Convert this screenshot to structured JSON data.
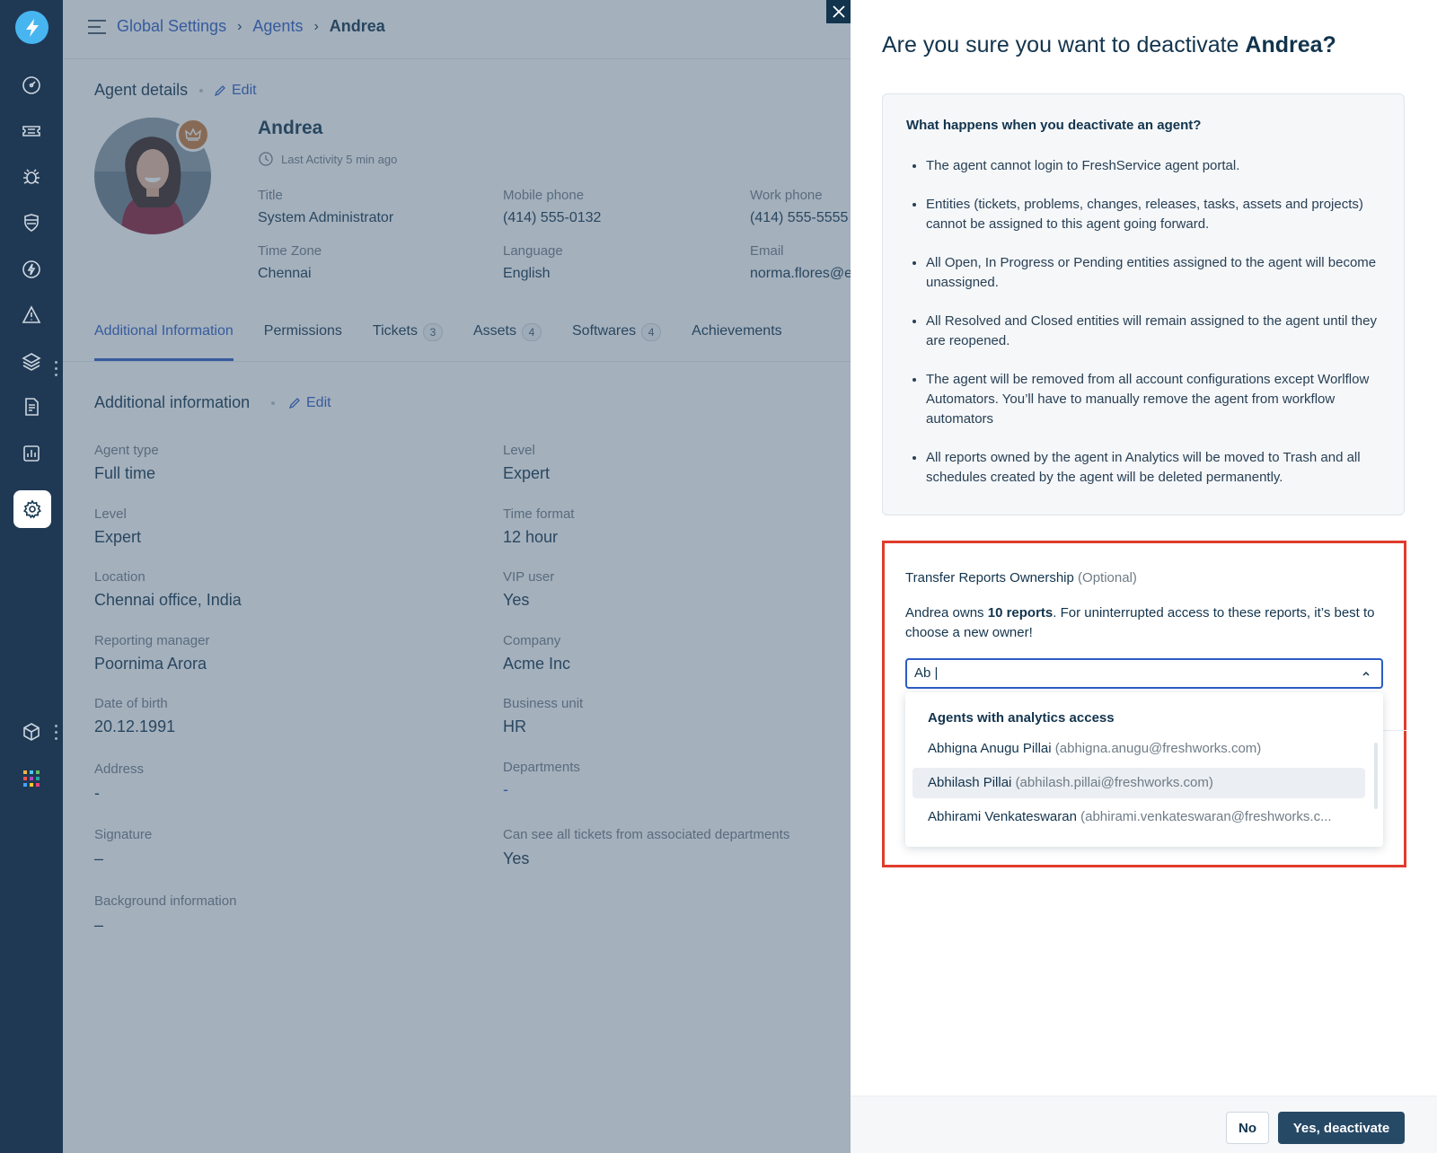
{
  "breadcrumb": {
    "root": "Global Settings",
    "section": "Agents",
    "current": "Andrea"
  },
  "agent_details": {
    "heading": "Agent details",
    "edit_label": "Edit",
    "name": "Andrea",
    "last_activity": "Last Activity 5 min ago",
    "fields": {
      "title_label": "Title",
      "title_value": "System Administrator",
      "mobile_label": "Mobile phone",
      "mobile_value": "(414) 555-0132",
      "work_label": "Work phone",
      "work_value": "(414) 555-5555",
      "tz_label": "Time Zone",
      "tz_value": "Chennai",
      "lang_label": "Language",
      "lang_value": "English",
      "email_label": "Email",
      "email_value": "norma.flores@e"
    }
  },
  "tabs": [
    {
      "label": "Additional Information"
    },
    {
      "label": "Permissions"
    },
    {
      "label": "Tickets",
      "count": "3"
    },
    {
      "label": "Assets",
      "count": "4"
    },
    {
      "label": "Softwares",
      "count": "4"
    },
    {
      "label": "Achievements"
    }
  ],
  "additional": {
    "heading": "Additional information",
    "edit_label": "Edit",
    "left": [
      {
        "label": "Agent type",
        "value": "Full time"
      },
      {
        "label": "Level",
        "value": "Expert"
      },
      {
        "label": "Location",
        "value": "Chennai office, India"
      },
      {
        "label": "Reporting manager",
        "value": "Poornima Arora"
      },
      {
        "label": "Date of birth",
        "value": "20.12.1991"
      },
      {
        "label": "Address",
        "value": "-"
      },
      {
        "label": "Signature",
        "value": "–"
      },
      {
        "label": "Background information",
        "value": "–"
      }
    ],
    "right": [
      {
        "label": "Level",
        "value": "Expert"
      },
      {
        "label": "Time format",
        "value": "12 hour"
      },
      {
        "label": "VIP user",
        "value": "Yes"
      },
      {
        "label": "Company",
        "value": "Acme Inc"
      },
      {
        "label": "Business unit",
        "value": "HR"
      },
      {
        "label": "Departments",
        "value": "-"
      },
      {
        "label": "Can see all tickets from associated departments",
        "value": "Yes"
      }
    ]
  },
  "dialog": {
    "title_prefix": "Are you sure you want to deactivate ",
    "title_name": "Andrea?",
    "info_question": "What happens when you deactivate an agent?",
    "info_items": [
      "The agent cannot login to FreshService agent portal.",
      "Entities (tickets, problems, changes, releases, tasks, assets and projects) cannot be assigned to this agent going forward.",
      "All Open, In Progress or Pending entities assigned to the agent will become unassigned.",
      "All Resolved and Closed entities will remain assigned to the agent until they are reopened.",
      "The agent will be removed from all account configurations except Worlflow Automators. You’ll have to manually remove the agent from workflow automators",
      "All reports owned by the agent in Analytics will be moved to Trash and all schedules created by the agent will be deleted permanently."
    ],
    "transfer": {
      "title": "Transfer Reports Ownership",
      "optional": "(Optional)",
      "desc_prefix": "Andrea owns ",
      "desc_bold": "10 reports",
      "desc_suffix": ". For uninterrupted access to these reports, it’s best to choose a new owner!",
      "search_value": "Ab |",
      "dropdown_heading": "Agents with analytics access",
      "options": [
        {
          "name": "Abhigna Anugu Pillai",
          "email": "(abhigna.anugu@freshworks.com)"
        },
        {
          "name": "Abhilash Pillai",
          "email": "(abhilash.pillai@freshworks.com)"
        },
        {
          "name": "Abhirami Venkateswaran",
          "email": "(abhirami.venkateswaran@freshworks.c..."
        }
      ]
    },
    "no_label": "No",
    "yes_label": "Yes, deactivate"
  },
  "colors": {
    "sidebar": "#1f3954",
    "accent": "#2c5cc5",
    "highlight_border": "#e03c2c",
    "primary_button": "#264966"
  },
  "icons": [
    "logo-bolt-icon",
    "dashboard-icon",
    "ticket-icon",
    "bug-icon",
    "shield-icon",
    "bolt-icon",
    "alert-icon",
    "layers-icon",
    "document-icon",
    "analytics-icon",
    "settings-icon",
    "cube-icon",
    "apps-grid-icon"
  ]
}
